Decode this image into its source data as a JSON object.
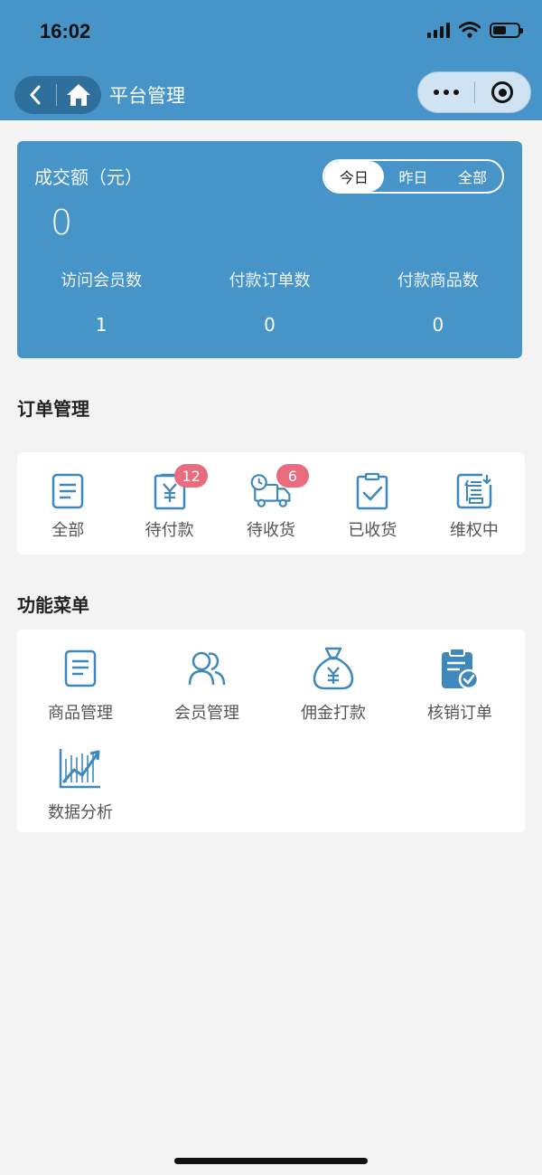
{
  "status_bar": {
    "time": "16:02"
  },
  "nav": {
    "title": "平台管理"
  },
  "stats": {
    "label": "成交额（元）",
    "amount": "0",
    "periods": [
      "今日",
      "昨日",
      "全部"
    ],
    "active_period": "今日",
    "metrics": [
      {
        "label": "访问会员数",
        "value": "1"
      },
      {
        "label": "付款订单数",
        "value": "0"
      },
      {
        "label": "付款商品数",
        "value": "0"
      }
    ]
  },
  "orders": {
    "title": "订单管理",
    "items": [
      {
        "label": "全部",
        "icon": "document-icon",
        "badge": null
      },
      {
        "label": "待付款",
        "icon": "payment-receipt-icon",
        "badge": "12"
      },
      {
        "label": "待收货",
        "icon": "delivery-truck-icon",
        "badge": "6"
      },
      {
        "label": "已收货",
        "icon": "clipboard-check-icon",
        "badge": null
      },
      {
        "label": "维权中",
        "icon": "after-sales-icon",
        "badge": null
      }
    ]
  },
  "menu": {
    "title": "功能菜单",
    "items": [
      {
        "label": "商品管理",
        "icon": "document-icon"
      },
      {
        "label": "会员管理",
        "icon": "members-icon"
      },
      {
        "label": "佣金打款",
        "icon": "money-bag-icon"
      },
      {
        "label": "核销订单",
        "icon": "clipboard-verified-icon"
      },
      {
        "label": "数据分析",
        "icon": "trend-chart-icon"
      }
    ]
  },
  "colors": {
    "primary": "#4694c8",
    "badge": "#e96b7e",
    "icon": "#3e88bb",
    "background": "#f3f3f3"
  }
}
